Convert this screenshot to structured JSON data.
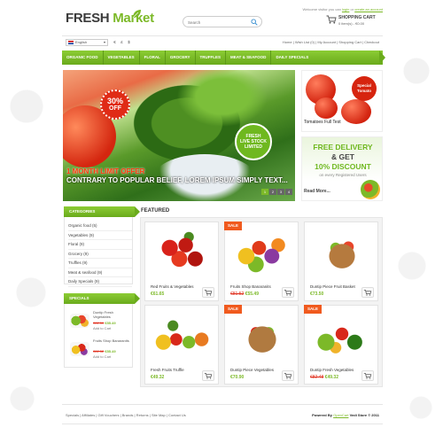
{
  "header": {
    "logo_part1": "FRESH",
    "logo_part2": "Market",
    "welcome_prefix": "Welcome visitor you can",
    "login_label": "login",
    "or_label": "or",
    "create_account_label": "create an account",
    "search_placeholder": "Search",
    "cart_title": "SHOPPING CART",
    "cart_items": "0 item(s) - €0.00"
  },
  "toolbar": {
    "language": "English",
    "currencies": [
      "€",
      "£",
      "$"
    ],
    "links": "Home | Wish List (0) | My Account | Shopping Cart | Checkout"
  },
  "nav": {
    "items": [
      "Organic Food",
      "Vegetables",
      "Floral",
      "Grocery",
      "Truffles",
      "Meat & Seafood",
      "Daily Specials"
    ]
  },
  "slider": {
    "badge_percent": "30%",
    "badge_off": "OFF",
    "fresh_line1": "FRESH",
    "fresh_line2": "LIVE STOCK",
    "fresh_line3": "LIMITED",
    "headline": "1 MONTH LIMIT OFFER",
    "subline": "CONTRARY TO POPULAR BELIEF, LOREM IPSUM SIMPLY TEXT...",
    "dots": [
      "1",
      "2",
      "3",
      "4"
    ],
    "active_dot": "1"
  },
  "side_banner_tomato": {
    "badge": "Special Tomato",
    "caption": "Tomatoes Full Test"
  },
  "side_banner_delivery": {
    "line1": "FREE DELIVERY",
    "line2": "& GET",
    "line3": "10% DISCOUNT",
    "line4": "on every Registered Users",
    "more": "Read More..."
  },
  "categories": {
    "title": "CATEGORIES",
    "items": [
      "Organic food (5)",
      "Vegetables (9)",
      "Floral (9)",
      "Grocery (9)",
      "Truffles (9)",
      "Meat & seafood (9)",
      "Daily Specials (9)"
    ]
  },
  "specials": {
    "title": "SPECIALS",
    "items": [
      {
        "name": "Duntip Fresh Vegetables",
        "old": "€82.50",
        "new": "€55.49",
        "action": "Add to Cart"
      },
      {
        "name": "Fruits Shop Banaranits",
        "old": "€82.52",
        "new": "€55.49",
        "action": "Add to Cart"
      }
    ]
  },
  "featured": {
    "title": "FEATURED",
    "sale_label": "SALE",
    "products": [
      {
        "name": "Red Fruits & Vegetables",
        "old": "",
        "price": "€61.65",
        "sale": false
      },
      {
        "name": "Fruits Shop Banaranits",
        "old": "€81.52",
        "price": "€55.49",
        "sale": true
      },
      {
        "name": "Duntip Piece Fruit Basket",
        "old": "",
        "price": "€73.50",
        "sale": false
      },
      {
        "name": "Fresh Fruits Truffle",
        "old": "",
        "price": "€49.32",
        "sale": false
      },
      {
        "name": "Duntip Piece Vegetables",
        "old": "",
        "price": "€70.90",
        "sale": true
      },
      {
        "name": "Duntip Fresh Vegetables",
        "old": "€82.48",
        "price": "€49.32",
        "sale": true
      }
    ]
  },
  "footer": {
    "links": "Specials | Affiliates | Gift Vouchers | Brands | Returns | Site Map | Contact Us",
    "powered_prefix": "Powered By",
    "powered_link": "OpenCart",
    "powered_suffix": "Vedi Store © 2011"
  },
  "colors": {
    "brand_green": "#7cb928",
    "sale_orange": "#f05a1e",
    "price_red": "#e0301e"
  }
}
